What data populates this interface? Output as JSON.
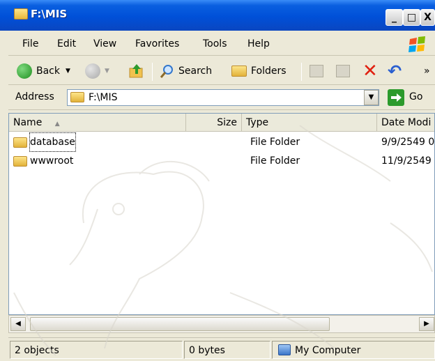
{
  "window": {
    "title": "F:\\MIS",
    "controls": {
      "minimize": "_",
      "maximize": "□",
      "close": "X"
    }
  },
  "menu": {
    "items": [
      "File",
      "Edit",
      "View",
      "Favorites",
      "Tools",
      "Help"
    ]
  },
  "toolbar": {
    "back_label": "Back",
    "search_label": "Search",
    "folders_label": "Folders",
    "overflow": "»"
  },
  "address": {
    "label": "Address",
    "value": "F:\\MIS",
    "go_label": "Go"
  },
  "list": {
    "columns": [
      "Name",
      "Size",
      "Type",
      "Date Modi"
    ],
    "rows": [
      {
        "name": "database",
        "size": "",
        "type": "File Folder",
        "date": "9/9/2549 0"
      },
      {
        "name": "wwwroot",
        "size": "",
        "type": "File Folder",
        "date": "11/9/2549"
      }
    ]
  },
  "status": {
    "objects": "2 objects",
    "size": "0 bytes",
    "location": "My Computer"
  },
  "colors": {
    "titlebar": "#0050d8",
    "face": "#ece9d8",
    "folder": "#f1c24e",
    "accent_green": "#2c9a2c"
  }
}
